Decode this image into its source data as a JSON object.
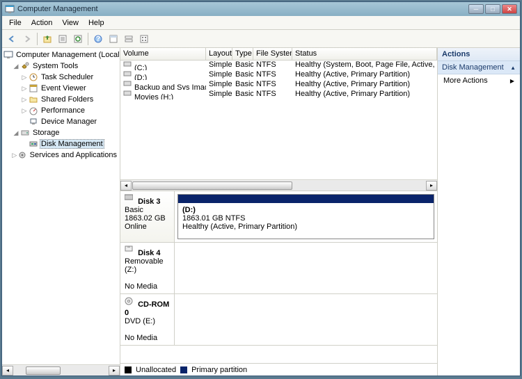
{
  "title": "Computer Management",
  "menu": [
    "File",
    "Action",
    "View",
    "Help"
  ],
  "tree": {
    "root": "Computer Management (Local)",
    "system_tools": "System Tools",
    "task_scheduler": "Task Scheduler",
    "event_viewer": "Event Viewer",
    "shared_folders": "Shared Folders",
    "performance": "Performance",
    "device_manager": "Device Manager",
    "storage": "Storage",
    "disk_management": "Disk Management",
    "services_apps": "Services and Applications"
  },
  "columns": [
    "Volume",
    "Layout",
    "Type",
    "File System",
    "Status"
  ],
  "volumes": [
    {
      "name": "(C:)",
      "layout": "Simple",
      "type": "Basic",
      "fs": "NTFS",
      "status": "Healthy (System, Boot, Page File, Active, Crash Dum"
    },
    {
      "name": "(D:)",
      "layout": "Simple",
      "type": "Basic",
      "fs": "NTFS",
      "status": "Healthy (Active, Primary Partition)"
    },
    {
      "name": "Backup and Sys Image (F:)",
      "layout": "Simple",
      "type": "Basic",
      "fs": "NTFS",
      "status": "Healthy (Active, Primary Partition)"
    },
    {
      "name": "Movies (H:)",
      "layout": "Simple",
      "type": "Basic",
      "fs": "NTFS",
      "status": "Healthy (Active, Primary Partition)"
    }
  ],
  "disks": {
    "disk3": {
      "title": "Disk 3",
      "type": "Basic",
      "size": "1863.02 GB",
      "state": "Online",
      "part": {
        "name": "(D:)",
        "desc": "1863.01 GB NTFS",
        "status": "Healthy (Active, Primary Partition)"
      }
    },
    "disk4": {
      "title": "Disk 4",
      "type": "Removable (Z:)",
      "media": "No Media"
    },
    "cdrom": {
      "title": "CD-ROM 0",
      "type": "DVD (E:)",
      "media": "No Media"
    }
  },
  "legend": {
    "unalloc": "Unallocated",
    "primary": "Primary partition"
  },
  "actions": {
    "header": "Actions",
    "section": "Disk Management",
    "more": "More Actions"
  }
}
